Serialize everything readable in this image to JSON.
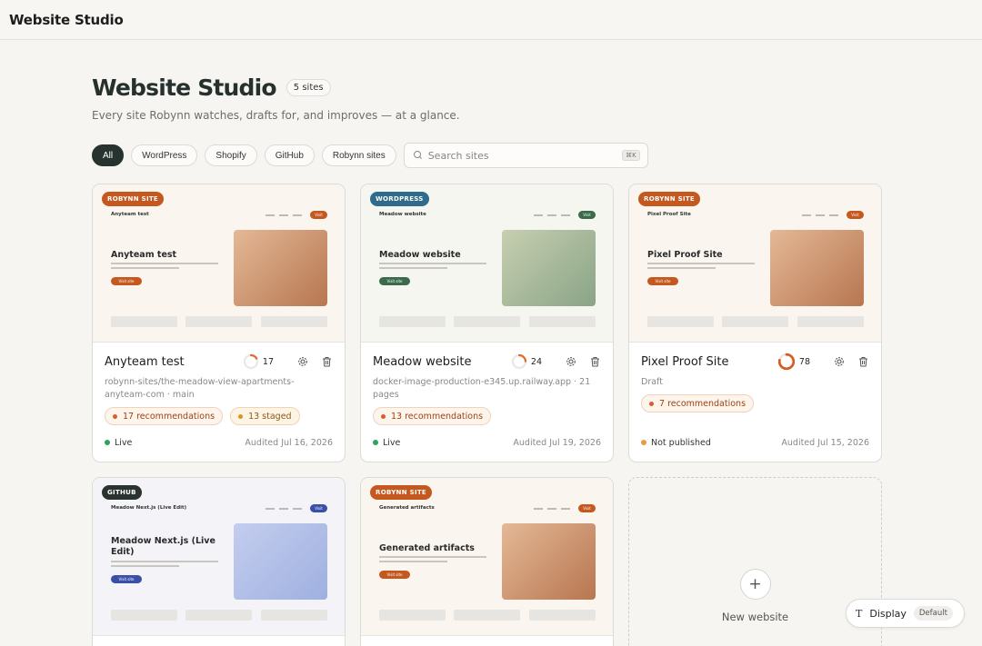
{
  "app": {
    "title": "Website Studio"
  },
  "header": {
    "title": "Website Studio",
    "count_label": "5 sites",
    "subtitle": "Every site Robynn watches, drafts for, and improves — at a glance."
  },
  "filters": {
    "chips": [
      "All",
      "WordPress",
      "Shopify",
      "GitHub",
      "Robynn sites"
    ],
    "active": "All",
    "search_placeholder": "Search sites",
    "search_value": "",
    "shortcut": "⌘K"
  },
  "colors": {
    "robynn": "#c4581f",
    "wordpress": "#2f6b8c",
    "github": "#2a332f",
    "green_accent": "#3c6b4c",
    "blue_accent": "#3a4fa8",
    "live": "#2fa35a",
    "not_published": "#e79a3f"
  },
  "sites": [
    {
      "tag": "ROBYNN SITE",
      "mini_brand": "Anyteam test",
      "mini_visit": "Visit",
      "mini_hero": "Anyteam test",
      "mini_btn": "Visit site",
      "title": "Anyteam test",
      "score": "17",
      "score_value": 17,
      "subtitle": "robynn-sites/the-meadow-view-apartments-anyteam-com · main",
      "recommendations": "17 recommendations",
      "staged": "13 staged",
      "status": "Live",
      "audited": "Audited Jul 16, 2026"
    },
    {
      "tag": "WORDPRESS",
      "mini_brand": "Meadow website",
      "mini_visit": "Visit",
      "mini_hero": "Meadow website",
      "mini_btn": "Visit site",
      "title": "Meadow website",
      "score": "24",
      "score_value": 24,
      "subtitle": "docker-image-production-e345.up.railway.app · 21 pages",
      "recommendations": "13 recommendations",
      "status": "Live",
      "audited": "Audited Jul 19, 2026"
    },
    {
      "tag": "ROBYNN SITE",
      "mini_brand": "Pixel Proof Site",
      "mini_visit": "Visit",
      "mini_hero": "Pixel Proof Site",
      "mini_btn": "Visit site",
      "title": "Pixel Proof Site",
      "score": "78",
      "score_value": 78,
      "subtitle": "Draft",
      "recommendations": "7 recommendations",
      "status": "Not published",
      "audited": "Audited Jul 15, 2026"
    },
    {
      "tag": "GITHUB",
      "mini_brand": "Meadow Next.js (Live Edit)",
      "mini_visit": "Visit",
      "mini_hero": "Meadow Next.js (Live Edit)",
      "mini_btn": "Visit site"
    },
    {
      "tag": "ROBYNN SITE",
      "mini_brand": "Generated artifacts",
      "mini_visit": "Visit",
      "mini_hero": "Generated artifacts",
      "mini_btn": "Visit site"
    }
  ],
  "new_website": {
    "label": "New website",
    "icon": "plus-icon"
  },
  "display": {
    "label": "Display",
    "value": "Default",
    "icon": "text-icon"
  }
}
